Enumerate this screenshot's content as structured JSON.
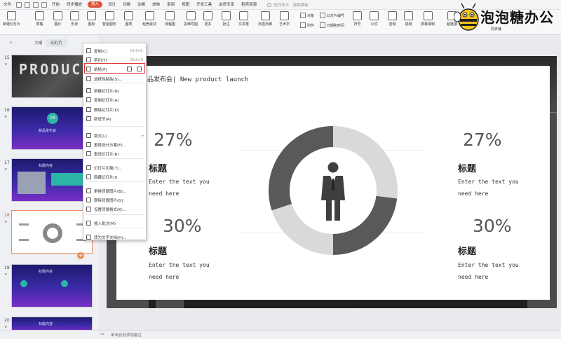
{
  "menubar": {
    "items": [
      "文件",
      "开始",
      "同步播放",
      "插入",
      "设计",
      "切换",
      "动画",
      "放映",
      "审阅",
      "视图",
      "开发工具",
      "会员专享",
      "稻壳资源"
    ],
    "active_index": 3,
    "search_placeholder": "查找命令、搜索模板"
  },
  "ribbon": {
    "buttons": [
      "新建幻灯片",
      "表格",
      "图片",
      "形状",
      "图标",
      "智能图形",
      "图表",
      "稻壳素材",
      "流程图",
      "思维导图",
      "更多",
      "批注",
      "文本框",
      "页眉页脚",
      "艺术字",
      "符号",
      "公式",
      "音频",
      "视频",
      "屏幕录制",
      "超链接",
      "同步播"
    ],
    "small": [
      "对象",
      "幻灯片编号",
      "附件",
      "日期和时间"
    ]
  },
  "logo": {
    "text": "泡泡糖办公",
    "icon": "bee-mascot-icon"
  },
  "left_panel": {
    "tabs": [
      "大纲",
      "幻灯片"
    ],
    "selected_tab": 1,
    "slides": [
      {
        "number": "15",
        "style": "dark",
        "title": "PRODUCT"
      },
      {
        "number": "16",
        "style": "purple",
        "badge": "04",
        "caption": "新品发布会"
      },
      {
        "number": "17",
        "style": "purple",
        "caption": "标题内容"
      },
      {
        "number": "18",
        "style": "white",
        "selected": true
      },
      {
        "number": "19",
        "style": "purple",
        "caption": "标题内容"
      },
      {
        "number": "20",
        "style": "purple",
        "caption": "标题内容"
      }
    ],
    "add_label": "+"
  },
  "context_menu": {
    "items": [
      {
        "label": "复制(C)",
        "shortcut": "Ctrl+C",
        "icon": "copy-icon"
      },
      {
        "label": "剪切(T)",
        "shortcut": "Ctrl+X",
        "icon": "cut-icon"
      },
      {
        "label": "粘贴(P)",
        "shortcut": "",
        "icon": "paste-icon",
        "highlighted": true
      },
      {
        "label": "选择性粘贴(S)...",
        "shortcut": "",
        "icon": "paste-special-icon"
      },
      {
        "label": "新建幻灯片(N)",
        "shortcut": "",
        "icon": "new-slide-icon"
      },
      {
        "label": "复制幻灯片(A)",
        "shortcut": "",
        "icon": "duplicate-slide-icon"
      },
      {
        "label": "删除幻灯片(D)",
        "shortcut": "",
        "icon": "delete-slide-icon"
      },
      {
        "label": "新增节(A)",
        "shortcut": "",
        "icon": "add-section-icon"
      },
      {
        "label": "版式(L)",
        "shortcut": "",
        "icon": "layout-icon",
        "submenu": true
      },
      {
        "label": "更换设计方案(E)...",
        "shortcut": "",
        "icon": "design-icon"
      },
      {
        "label": "重设幻灯片(R)",
        "shortcut": "",
        "icon": "reset-slide-icon"
      },
      {
        "label": "幻灯片切换(T)...",
        "shortcut": "",
        "icon": "transition-icon"
      },
      {
        "label": "隐藏幻灯片(I)",
        "shortcut": "",
        "icon": "hide-slide-icon"
      },
      {
        "label": "更换背景图片(B)...",
        "shortcut": "",
        "icon": "change-bg-icon"
      },
      {
        "label": "删除背景图片(G)",
        "shortcut": "",
        "icon": "delete-bg-icon"
      },
      {
        "label": "设置背景格式(K)...",
        "shortcut": "",
        "icon": "bg-format-icon"
      },
      {
        "label": "插入批注(M)",
        "shortcut": "",
        "icon": "comment-icon"
      },
      {
        "label": "转为文字文档(H)...",
        "shortcut": "",
        "icon": "convert-doc-icon"
      }
    ]
  },
  "slide": {
    "header": "品发布会| New product launch",
    "blocks": [
      {
        "percent": "27%",
        "title": "标题",
        "desc1": "Enter the text you",
        "desc2": "need here"
      },
      {
        "percent": "30%",
        "title": "标题",
        "desc1": "Enter the text you",
        "desc2": "need here"
      },
      {
        "percent": "27%",
        "title": "标题",
        "desc1": "Enter the text you",
        "desc2": "need here"
      },
      {
        "percent": "30%",
        "title": "标题",
        "desc1": "Enter the text you",
        "desc2": "need here"
      }
    ],
    "donut": {
      "segments": [
        {
          "value": 27,
          "color": "#d9d9d9"
        },
        {
          "value": 23,
          "color": "#595959"
        },
        {
          "value": 20,
          "color": "#d9d9d9"
        },
        {
          "value": 30,
          "color": "#595959"
        }
      ],
      "center_icon": "businessman-icon"
    }
  },
  "statusbar": {
    "text": "单击此处添加备注"
  }
}
